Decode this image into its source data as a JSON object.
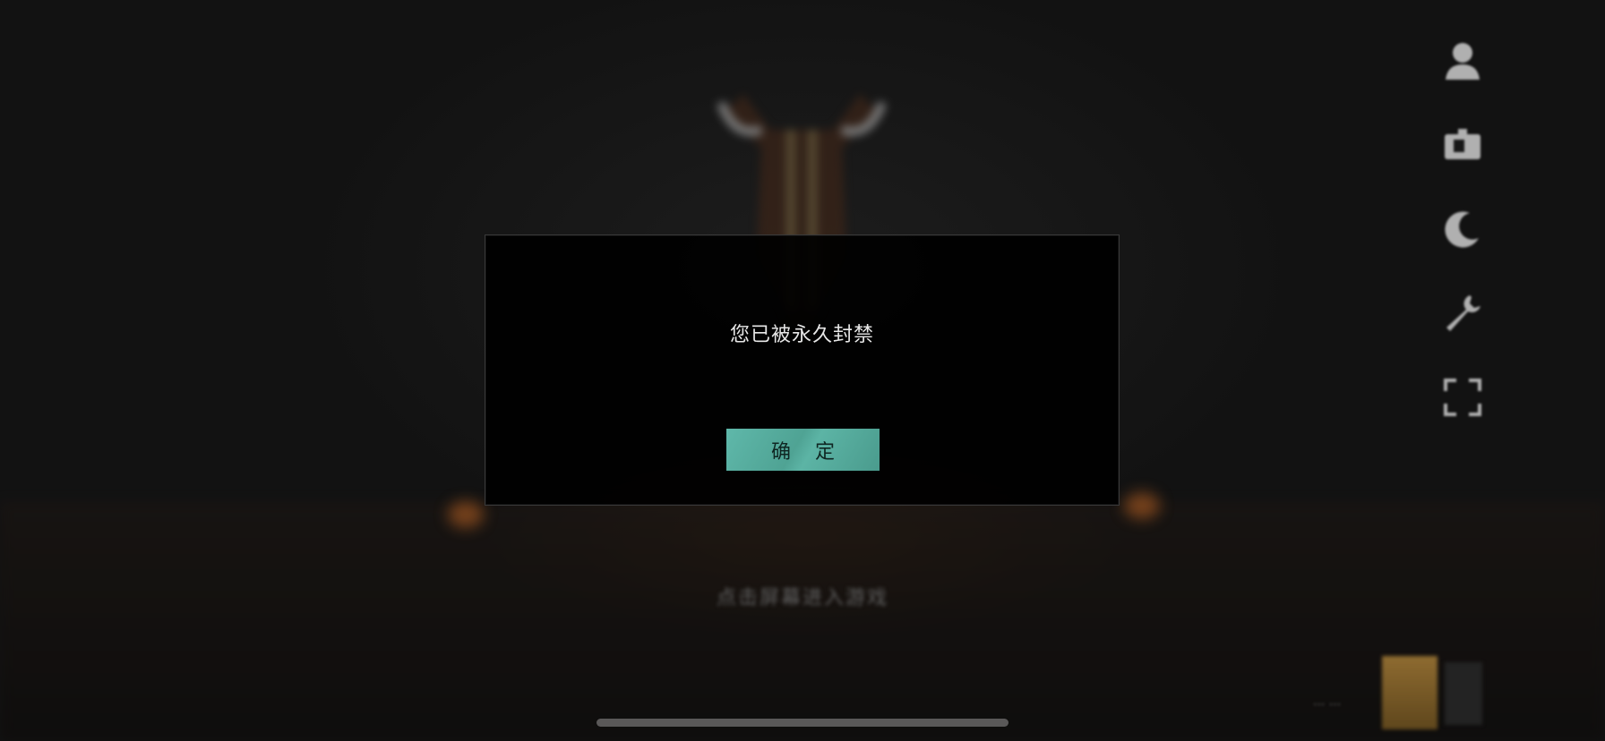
{
  "dialog": {
    "message": "您已被永久封禁",
    "confirm_label": "确 定",
    "accent_color": "#55ac9e"
  },
  "side_icons": [
    {
      "name": "profile-icon"
    },
    {
      "name": "gift-box-icon"
    },
    {
      "name": "moon-icon"
    },
    {
      "name": "wrench-icon"
    },
    {
      "name": "fullscreen-icon"
    }
  ]
}
